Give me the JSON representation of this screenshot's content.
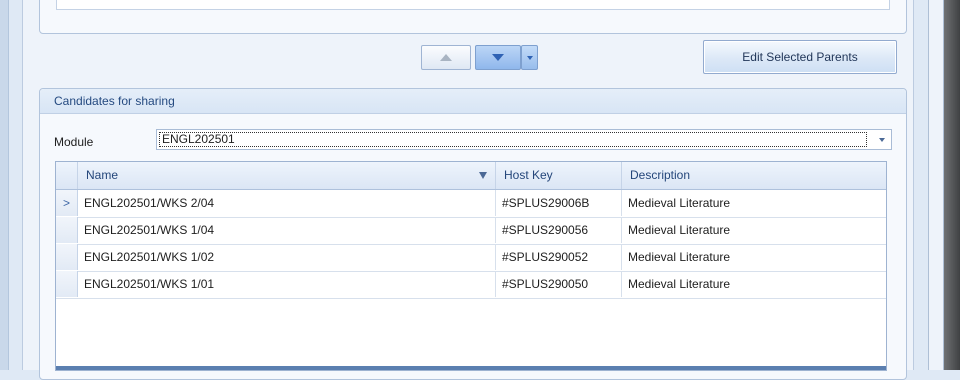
{
  "toolbar": {
    "move_up_icon": "triangle-up",
    "move_down_icon": "triangle-down",
    "edit_selected_parents_label": "Edit Selected Parents"
  },
  "candidates": {
    "title": "Candidates for sharing",
    "module_label": "Module",
    "module_value": "ENGL202501"
  },
  "grid": {
    "columns": [
      "Name",
      "Host Key",
      "Description"
    ],
    "rows": [
      {
        "indicator": ">",
        "name": "ENGL202501/WKS 2/04",
        "host_key": "#SPLUS29006B",
        "description": "Medieval Literature"
      },
      {
        "indicator": "",
        "name": "ENGL202501/WKS 1/04",
        "host_key": "#SPLUS290056",
        "description": "Medieval Literature"
      },
      {
        "indicator": "",
        "name": "ENGL202501/WKS 1/02",
        "host_key": "#SPLUS290052",
        "description": "Medieval Literature"
      },
      {
        "indicator": "",
        "name": "ENGL202501/WKS 1/01",
        "host_key": "#SPLUS290050",
        "description": "Medieval Literature"
      }
    ]
  },
  "colors": {
    "accent": "#2f62b4",
    "panel_background": "#eef3fa",
    "group_header": "#d8e5f5"
  }
}
